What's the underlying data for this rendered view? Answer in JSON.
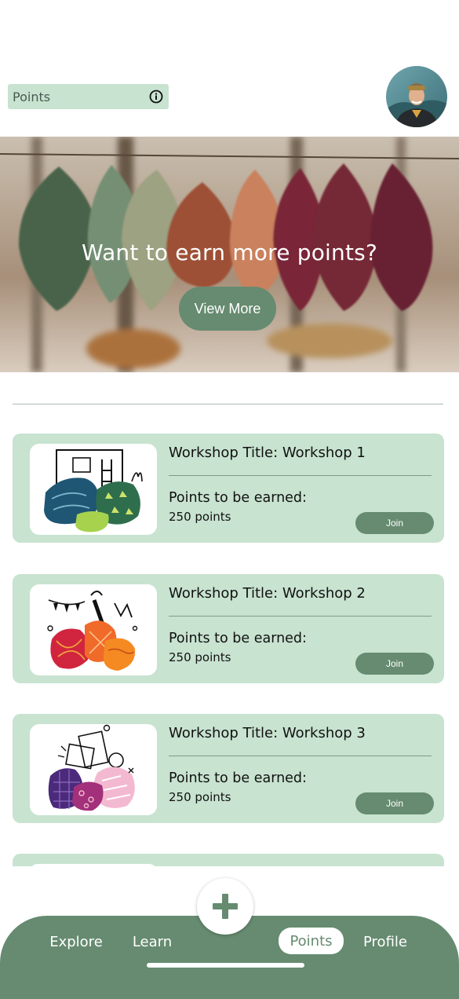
{
  "header": {
    "section_label": "Points",
    "info_icon": "info-circle-icon"
  },
  "hero": {
    "title": "Want to earn more points?",
    "button_label": "View More"
  },
  "workshops": [
    {
      "title": "Workshop Title: Workshop 1",
      "points_label": "Points to be earned:",
      "points_value": "250 points",
      "join_label": "Join"
    },
    {
      "title": "Workshop Title: Workshop 2",
      "points_label": "Points to be earned:",
      "points_value": "250 points",
      "join_label": "Join"
    },
    {
      "title": "Workshop Title: Workshop 3",
      "points_label": "Points to be earned:",
      "points_value": "250 points",
      "join_label": "Join"
    }
  ],
  "nav": {
    "explore": "Explore",
    "learn": "Learn",
    "points": "Points",
    "profile": "Profile",
    "active": "points",
    "add_icon": "plus-icon"
  },
  "colors": {
    "accent": "#668b70",
    "card_bg": "#c8e3d0",
    "text": "#111111"
  }
}
